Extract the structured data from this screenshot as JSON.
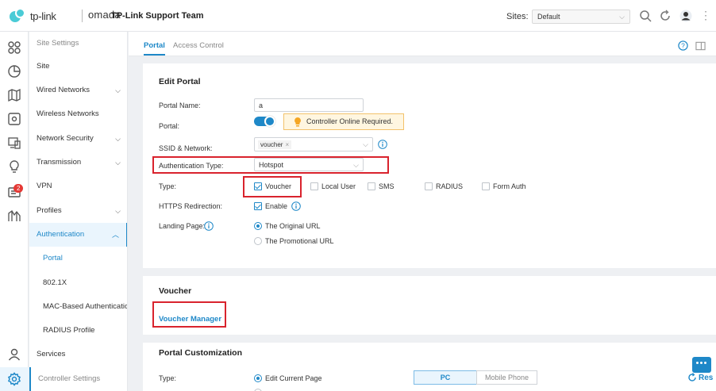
{
  "header": {
    "brand": "tp-link",
    "product": "omada",
    "title": "TP-Link Support Team",
    "sites_label": "Sites:",
    "sites_value": "Default"
  },
  "nav": {
    "items": [
      {
        "label": "Site Settings"
      },
      {
        "label": "Site"
      },
      {
        "label": "Wired Networks"
      },
      {
        "label": "Wireless Networks"
      },
      {
        "label": "Network Security"
      },
      {
        "label": "Transmission"
      },
      {
        "label": "VPN"
      },
      {
        "label": "Profiles"
      },
      {
        "label": "Authentication"
      },
      {
        "label": "Portal"
      },
      {
        "label": "802.1X"
      },
      {
        "label": "MAC-Based Authentication"
      },
      {
        "label": "RADIUS Profile"
      },
      {
        "label": "Services"
      },
      {
        "label": "Controller Settings"
      }
    ],
    "badge": "2"
  },
  "tabs": [
    {
      "label": "Portal"
    },
    {
      "label": "Access Control"
    }
  ],
  "edit_portal": {
    "title": "Edit Portal",
    "portal_name_label": "Portal Name:",
    "portal_name_value": "a",
    "portal_label": "Portal:",
    "warning": "Controller Online Required.",
    "ssid_label": "SSID & Network:",
    "ssid_tag": "voucher",
    "ssid_tag_x": "×",
    "auth_type_label": "Authentication Type:",
    "auth_type_value": "Hotspot",
    "type_label": "Type:",
    "types": [
      {
        "label": "Voucher",
        "checked": true
      },
      {
        "label": "Local User",
        "checked": false
      },
      {
        "label": "SMS",
        "checked": false
      },
      {
        "label": "RADIUS",
        "checked": false
      },
      {
        "label": "Form Auth",
        "checked": false
      }
    ],
    "https_label": "HTTPS Redirection:",
    "https_value": "Enable",
    "landing_label": "Landing Page:",
    "landing_options": [
      {
        "label": "The Original URL",
        "selected": true
      },
      {
        "label": "The Promotional URL",
        "selected": false
      }
    ]
  },
  "voucher": {
    "title": "Voucher",
    "manager_link": "Voucher Manager"
  },
  "customization": {
    "title": "Portal Customization",
    "type_label": "Type:",
    "option": "Edit Current Page",
    "segments": [
      {
        "label": "PC",
        "active": true
      },
      {
        "label": "Mobile Phone",
        "active": false
      }
    ],
    "restore_label": "Res"
  },
  "colors": {
    "accent": "#1e88c8",
    "highlight_box": "#d9232d",
    "warning_bg": "#fff6e0",
    "badge": "#e53935"
  }
}
